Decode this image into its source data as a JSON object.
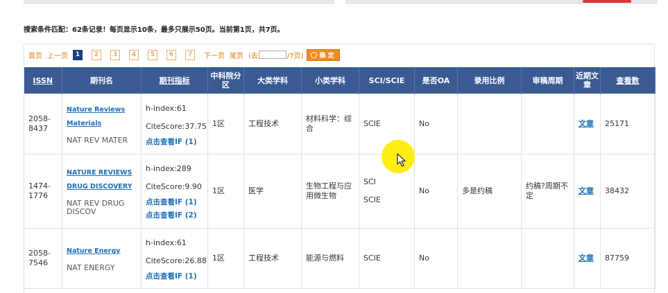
{
  "summary": "搜索条件匹配：62条记录！每页显示10条，最多只展示50页。当前第1页，共7页。",
  "pager": {
    "first": "首页",
    "prev": "上一页",
    "pages": [
      "1",
      "2",
      "3",
      "4",
      "5",
      "6",
      "7"
    ],
    "current": "1",
    "next": "下一页",
    "last": "尾页",
    "jump_prefix": "(去",
    "jump_suffix": "/7页)",
    "ok_label": "确 定"
  },
  "table": {
    "headers": {
      "issn": "ISSN",
      "name": "期刊名",
      "metric": "期刊指标",
      "cas": "中科院分区",
      "major": "大类学科",
      "minor": "小类学科",
      "sci": "SCI/SCIE",
      "oa": "是否OA",
      "rate": "录用比例",
      "cycle": "审稿周期",
      "recent": "近期文章",
      "views": "查看数"
    },
    "rows": [
      {
        "issn": "2058-8437",
        "title_lines": [
          "Nature Reviews",
          "Materials"
        ],
        "abbr": "NAT REV MATER",
        "hindex": "h-index:61",
        "citescore": "CiteScore:37.75",
        "if_links": [
          "点击查看IF (1)"
        ],
        "cas": "1区",
        "major": "工程技术",
        "minor": "材料科学：综合",
        "sci": [
          "SCIE"
        ],
        "oa": "No",
        "rate": "",
        "cycle": "",
        "article": "文章",
        "views": "25171"
      },
      {
        "issn": "1474-1776",
        "title_lines": [
          "NATURE REVIEWS",
          "DRUG DISCOVERY"
        ],
        "abbr": "NAT REV DRUG DISCOV",
        "hindex": "h-index:289",
        "citescore": "CiteScore:9.90",
        "if_links": [
          "点击查看IF (1)",
          "点击查看IF (2)"
        ],
        "cas": "1区",
        "major": "医学",
        "minor": "生物工程与应用微生物",
        "sci": [
          "SCI",
          "SCIE"
        ],
        "oa": "No",
        "rate": "多是约稿",
        "cycle": "约稿?周期不定",
        "article": "文章",
        "views": "38432"
      },
      {
        "issn": "2058-7546",
        "title_lines": [
          "Nature Energy"
        ],
        "abbr": "NAT ENERGY",
        "hindex": "h-index:61",
        "citescore": "CiteScore:26.88",
        "if_links": [
          "点击查看IF (1)"
        ],
        "cas": "1区",
        "major": "工程技术",
        "minor": "能源与燃料",
        "sci": [
          "SCIE"
        ],
        "oa": "No",
        "rate": "",
        "cycle": "",
        "article": "文章",
        "views": "87759"
      }
    ]
  }
}
